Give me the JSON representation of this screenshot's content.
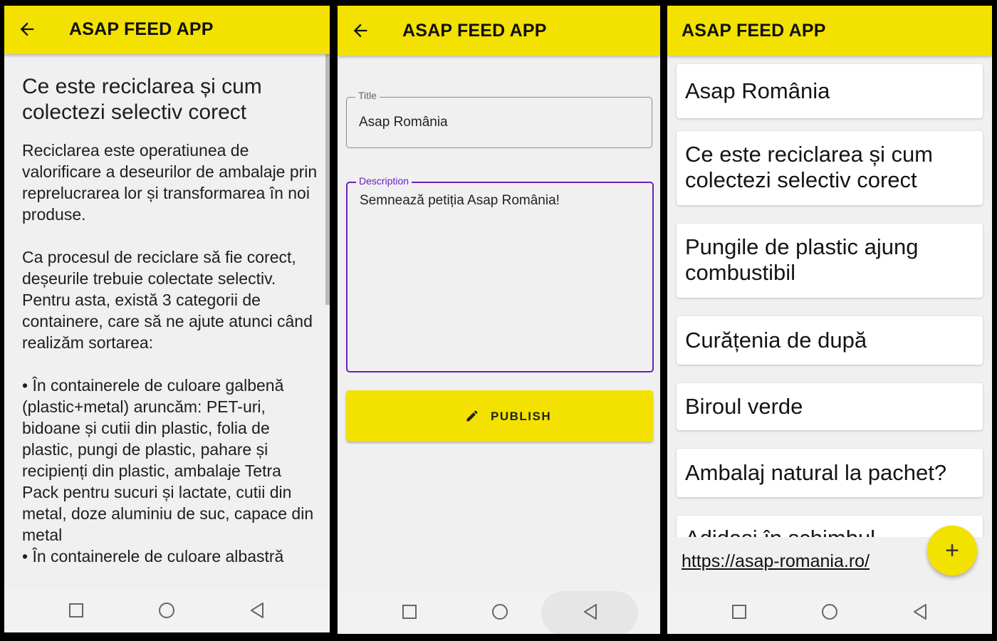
{
  "app": {
    "title": "ASAP FEED APP"
  },
  "detail_screen": {
    "heading": "Ce este reciclarea și cum colectezi selectiv corect",
    "paragraphs": [
      "Reciclarea este operatiunea de valorificare a deseurilor de ambalaje prin reprelucrarea lor și transformarea în noi produse.",
      "Ca procesul de reciclare să fie corect, deșeurile trebuie colectate selectiv. Pentru asta, există 3 categorii de containere, care să ne ajute atunci când realizăm sortarea:",
      "• În containerele de culoare galbenă (plastic+metal) aruncăm: PET-uri, bidoane și cutii din plastic, folia de plastic, pungi de plastic, pahare și recipienți din plastic, ambalaje Tetra Pack pentru sucuri și lactate, cutii din metal, doze aluminiu de suc, capace din metal",
      "• În containerele de culoare albastră"
    ]
  },
  "edit_screen": {
    "title_label": "Title",
    "title_value": "Asap România",
    "description_label": "Description",
    "description_value": "Semnează petiția Asap România!",
    "publish_label": "PUBLISH",
    "publish_icon": "pencil-icon"
  },
  "feed_screen": {
    "items": [
      "Asap România",
      "Ce este reciclarea și cum colectezi selectiv corect",
      "Pungile de plastic ajung combustibil",
      "Curățenia de după",
      "Biroul verde",
      "Ambalaj natural la pachet?",
      "Adidași în schimbul"
    ],
    "link": "https://asap-romania.ro/",
    "fab_icon": "plus-icon"
  },
  "navigation": {
    "icons": [
      "square-recents-icon",
      "circle-home-icon",
      "triangle-back-icon"
    ]
  },
  "colors": {
    "accent": "#f3e100",
    "focus": "#6a1fc2",
    "background": "#f0f0f0"
  }
}
